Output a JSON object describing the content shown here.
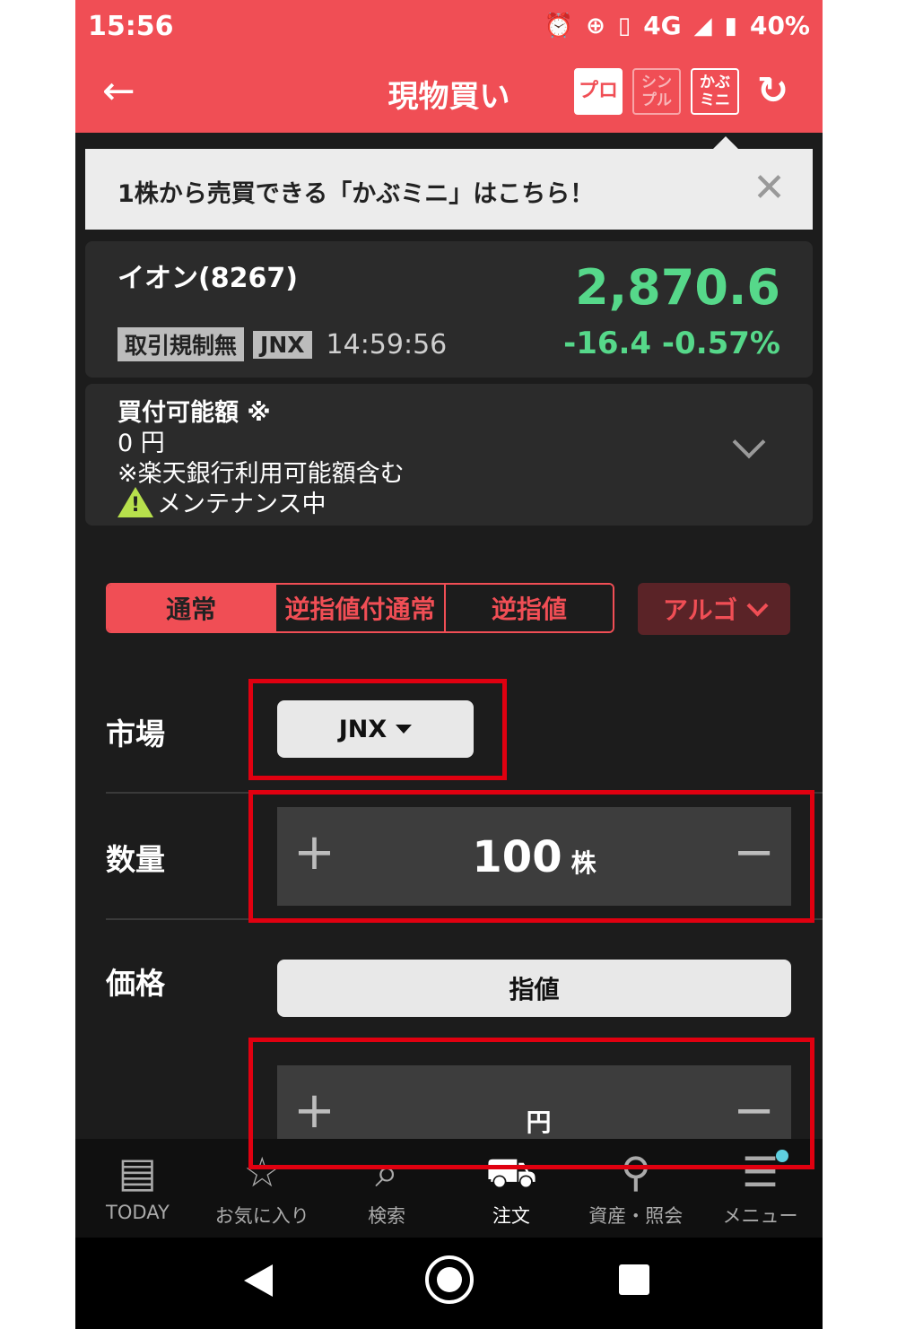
{
  "status": {
    "time": "15:56",
    "network": "4G",
    "battery": "40%"
  },
  "header": {
    "title": "現物買い",
    "modes": [
      {
        "label": "プロ",
        "active": true
      },
      {
        "label": "シンプル",
        "active": false
      },
      {
        "label": "かぶミニ",
        "active": false
      }
    ]
  },
  "banner": {
    "text": "1株から売買できる「かぶミニ」はこちら！"
  },
  "stock": {
    "name": "イオン(8267)",
    "price": "2,870.6",
    "tag1": "取引規制無",
    "tag2": "JNX",
    "time": "14:59:56",
    "change": "-16.4 -0.57%"
  },
  "buying_power": {
    "label": "買付可能額 ※",
    "amount": "0 円",
    "note": "※楽天銀行利用可能額含む",
    "warning": "メンテナンス中"
  },
  "order_tabs": [
    "通常",
    "逆指値付通常",
    "逆指値"
  ],
  "algo_label": "アルゴ",
  "form": {
    "market_label": "市場",
    "market_value": "JNX",
    "quantity_label": "数量",
    "quantity_value": "100",
    "quantity_unit": "株",
    "price_label": "価格",
    "price_type": "指値",
    "price_unit": "円",
    "plus": "+",
    "minus": "−"
  },
  "nav": [
    "TODAY",
    "お気に入り",
    "検索",
    "注文",
    "資産・照会",
    "メニュー"
  ],
  "colors": {
    "brand": "#f04e55",
    "price_green": "#56d88a",
    "highlight": "#e00010"
  }
}
